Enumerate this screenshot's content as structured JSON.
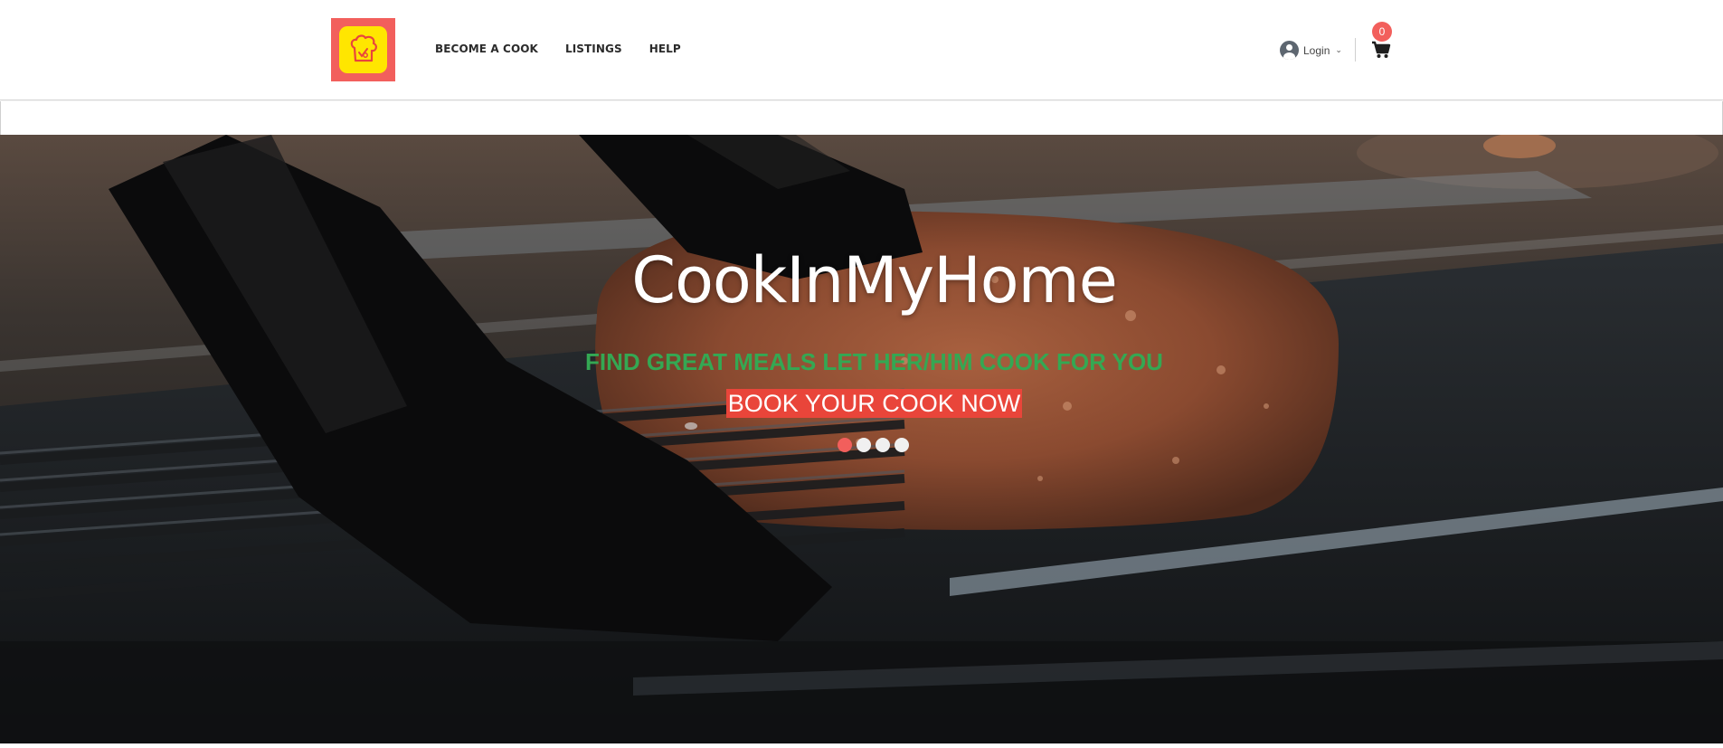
{
  "brand": {
    "logo_alt": "CookInMyHome logo",
    "logo_icon": "chef-hat-icon",
    "colors": {
      "accent": "#f25f5c",
      "logo_yellow": "#ffe600",
      "subtitle_green": "#34a853",
      "cta_red": "#e9453a"
    }
  },
  "nav": {
    "items": [
      {
        "label": "BECOME A COOK"
      },
      {
        "label": "LISTINGS"
      },
      {
        "label": "HELP"
      }
    ]
  },
  "account": {
    "login_label": "Login",
    "user_icon": "user-circle-icon",
    "dropdown_icon": "chevron-down-icon"
  },
  "cart": {
    "icon": "shopping-cart-icon",
    "count": "0"
  },
  "hero": {
    "title": "CookInMyHome",
    "subtitle": "FIND GREAT MEALS LET HER/HIM COOK FOR YOU",
    "cta_label": "BOOK YOUR COOK NOW",
    "slides": {
      "total": 4,
      "active_index": 0
    }
  }
}
